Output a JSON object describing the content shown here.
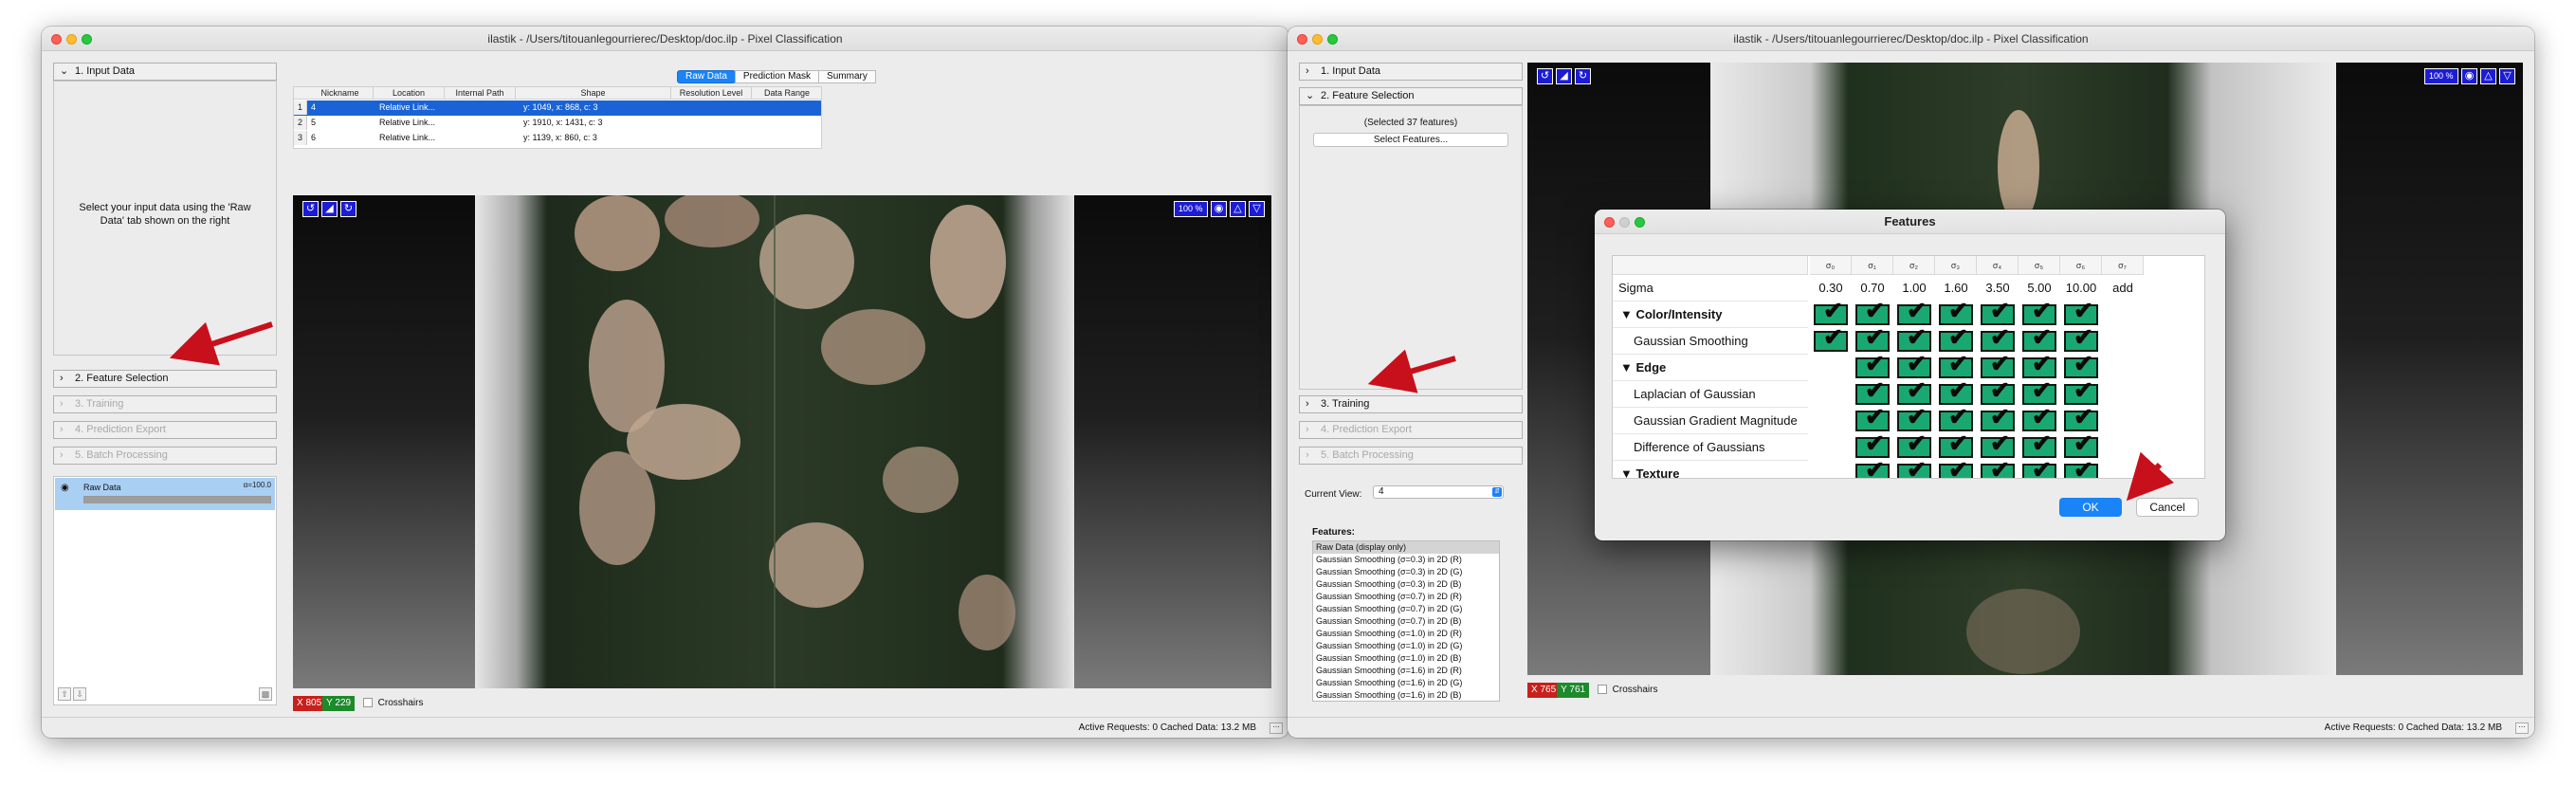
{
  "colors": {
    "accent_blue": "#1a83f7",
    "arrow_red": "#c8101c",
    "checkbox_green": "#1aa872",
    "coord_x_red": "#c8201c",
    "coord_y_green": "#1d8a2c",
    "selected_row": "#1a63d6",
    "layer_highlight": "#a9cff3"
  },
  "left_window": {
    "title": "ilastik - /Users/titouanlegourrierec/Desktop/doc.ilp - Pixel Classification",
    "applets": [
      {
        "label": "1. Input Data",
        "icon": "chevron-down-icon",
        "enabled": true
      },
      {
        "label": "2. Feature Selection",
        "icon": "chevron-right-icon",
        "enabled": true
      },
      {
        "label": "3. Training",
        "icon": "chevron-right-icon",
        "enabled": false
      },
      {
        "label": "4. Prediction Export",
        "icon": "chevron-right-icon",
        "enabled": false
      },
      {
        "label": "5. Batch Processing",
        "icon": "chevron-right-icon",
        "enabled": false
      }
    ],
    "hint": "Select your input data using the 'Raw Data' tab shown on the right",
    "layer": {
      "name": "Raw Data",
      "alpha_label": "α=100.0",
      "opacity": 1.0,
      "eye_icon": "eye-icon"
    },
    "tabs": [
      {
        "label": "Raw Data",
        "active": true
      },
      {
        "label": "Prediction Mask",
        "active": false
      },
      {
        "label": "Summary",
        "active": false
      }
    ],
    "table": {
      "headers": [
        "Nickname",
        "Location",
        "Internal Path",
        "Shape",
        "Resolution Level",
        "Data Range"
      ],
      "rows": [
        {
          "num": "1",
          "nickname": "4",
          "location": "Relative Link...",
          "internal_path": "",
          "shape": "y: 1049, x: 868, c: 3",
          "selected": true
        },
        {
          "num": "2",
          "nickname": "5",
          "location": "Relative Link...",
          "internal_path": "",
          "shape": "y: 1910, x: 1431, c: 3",
          "selected": false
        },
        {
          "num": "3",
          "nickname": "6",
          "location": "Relative Link...",
          "internal_path": "",
          "shape": "y: 1139, x: 860, c: 3",
          "selected": false
        }
      ]
    },
    "viewer": {
      "zoom": "100 %",
      "icons": [
        "undo-icon",
        "fit-icon",
        "redo-icon",
        "camera-icon",
        "up-arrow-icon",
        "down-arrow-icon"
      ]
    },
    "coords": {
      "x_label": "X",
      "x": "805",
      "y_label": "Y",
      "y": "229"
    },
    "crosshairs_label": "Crosshairs",
    "status": "Active Requests: 0  Cached Data: 13.2 MB"
  },
  "right_window": {
    "title": "ilastik - /Users/titouanlegourrierec/Desktop/doc.ilp - Pixel Classification",
    "applets": [
      {
        "label": "1. Input Data",
        "icon": "chevron-right-icon",
        "enabled": true
      },
      {
        "label": "2. Feature Selection",
        "icon": "chevron-down-icon",
        "enabled": true
      },
      {
        "label": "3. Training",
        "icon": "chevron-right-icon",
        "enabled": true
      },
      {
        "label": "4. Prediction Export",
        "icon": "chevron-right-icon",
        "enabled": false
      },
      {
        "label": "5. Batch Processing",
        "icon": "chevron-right-icon",
        "enabled": false
      }
    ],
    "selected_count": "(Selected 37 features)",
    "select_button": "Select Features...",
    "current_view_label": "Current View:",
    "current_view_value": "4",
    "features_label": "Features:",
    "feature_list": [
      "Raw Data (display only)",
      "Gaussian Smoothing (σ=0.3) in 2D (R)",
      "Gaussian Smoothing (σ=0.3) in 2D (G)",
      "Gaussian Smoothing (σ=0.3) in 2D (B)",
      "Gaussian Smoothing (σ=0.7) in 2D (R)",
      "Gaussian Smoothing (σ=0.7) in 2D (G)",
      "Gaussian Smoothing (σ=0.7) in 2D (B)",
      "Gaussian Smoothing (σ=1.0) in 2D (R)",
      "Gaussian Smoothing (σ=1.0) in 2D (G)",
      "Gaussian Smoothing (σ=1.0) in 2D (B)",
      "Gaussian Smoothing (σ=1.6) in 2D (R)",
      "Gaussian Smoothing (σ=1.6) in 2D (G)",
      "Gaussian Smoothing (σ=1.6) in 2D (B)"
    ],
    "viewer": {
      "zoom": "100 %"
    },
    "coords": {
      "x_label": "X",
      "x": "765",
      "y_label": "Y",
      "y": "761"
    },
    "crosshairs_label": "Crosshairs",
    "status": "Active Requests: 0  Cached Data: 13.2 MB"
  },
  "features_dialog": {
    "title": "Features",
    "column_headers": [
      "σ₀",
      "σ₁",
      "σ₂",
      "σ₃",
      "σ₄",
      "σ₅",
      "σ₆",
      "σ₇"
    ],
    "sigma_label": "Sigma",
    "sigma_values": [
      "0.30",
      "0.70",
      "1.00",
      "1.60",
      "3.50",
      "5.00",
      "10.00",
      "add"
    ],
    "rows": [
      {
        "label": "▼ Color/Intensity",
        "kind": "section",
        "checks": [
          true,
          true,
          true,
          true,
          true,
          true,
          true
        ]
      },
      {
        "label": "Gaussian Smoothing",
        "kind": "sub",
        "checks": [
          true,
          true,
          true,
          true,
          true,
          true,
          true
        ]
      },
      {
        "label": "▼ Edge",
        "kind": "section",
        "checks": [
          false,
          true,
          true,
          true,
          true,
          true,
          true
        ]
      },
      {
        "label": "Laplacian of Gaussian",
        "kind": "sub",
        "checks": [
          false,
          true,
          true,
          true,
          true,
          true,
          true
        ]
      },
      {
        "label": "Gaussian Gradient Magnitude",
        "kind": "sub",
        "checks": [
          false,
          true,
          true,
          true,
          true,
          true,
          true
        ]
      },
      {
        "label": "Difference of Gaussians",
        "kind": "sub",
        "checks": [
          false,
          true,
          true,
          true,
          true,
          true,
          true
        ]
      },
      {
        "label": "▼ Texture",
        "kind": "section",
        "checks": [
          false,
          true,
          true,
          true,
          true,
          true,
          true
        ]
      }
    ],
    "ok_label": "OK",
    "cancel_label": "Cancel"
  }
}
